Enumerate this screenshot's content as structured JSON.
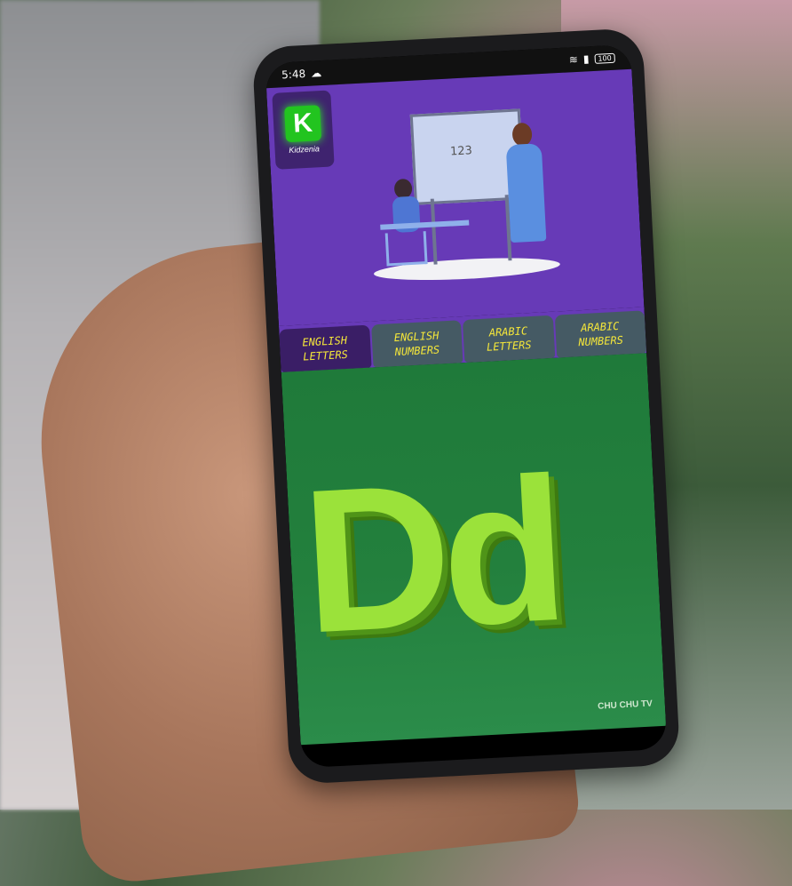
{
  "status_bar": {
    "time": "5:48",
    "battery": "100"
  },
  "logo": {
    "letter": "K",
    "name": "Kidzenia"
  },
  "hero": {
    "board_text": "123"
  },
  "tabs": [
    {
      "line1": "ENGLISH",
      "line2": "LETTERS",
      "active": true
    },
    {
      "line1": "ENGLISH",
      "line2": "NUMBERS",
      "active": false
    },
    {
      "line1": "ARABIC",
      "line2": "LETTERS",
      "active": false
    },
    {
      "line1": "ARABIC",
      "line2": "NUMBERS",
      "active": false
    }
  ],
  "content": {
    "letter_display": "Dd",
    "watermark": "CHU CHU TV"
  },
  "colors": {
    "hero_bg": "#673ab7",
    "tab_bg": "#455a64",
    "tab_active_bg": "#3a1e66",
    "tab_text": "#f4e63a",
    "content_bg": "#23803d",
    "letter": "#9be23a",
    "logo_green": "#22c41f"
  },
  "icons": [
    "cloud-icon",
    "wifi-icon",
    "signal-icon",
    "battery-icon"
  ]
}
